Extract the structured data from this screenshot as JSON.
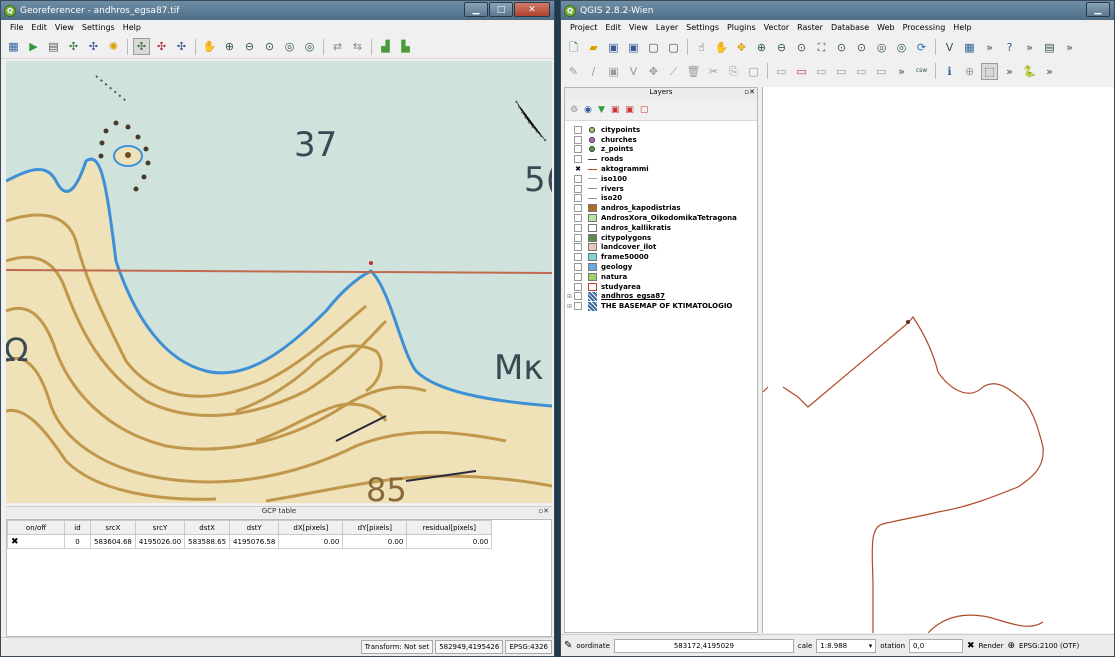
{
  "georef": {
    "title": "Georeferencer - andhros_egsa87.tif",
    "menu": [
      "File",
      "Edit",
      "View",
      "Settings",
      "Help"
    ],
    "toolbar_icons": [
      "add-raster-icon",
      "start-georeferencing-icon",
      "generate-gdal-script-icon",
      "load-gcp-icon",
      "save-gcp-icon",
      "transformation-settings-icon",
      "add-point-icon",
      "delete-point-icon",
      "move-point-icon",
      "pan-icon",
      "zoom-in-icon",
      "zoom-out-icon",
      "zoom-to-layer-icon",
      "zoom-last-icon",
      "zoom-next-icon",
      "link-georef-to-qgis-icon",
      "link-qgis-to-georef-icon",
      "raster-histogram-icon",
      "raster-stretch-icon"
    ],
    "map_labels": {
      "number_37": "37",
      "number_5": "5(",
      "label_mk": "Mκ",
      "label_85": "85",
      "label_q": "Ω"
    },
    "gcp": {
      "title": "GCP table",
      "columns": [
        "on/off",
        "id",
        "srcX",
        "srcY",
        "dstX",
        "dstY",
        "dX[pixels]",
        "dY[pixels]",
        "residual[pixels]"
      ],
      "rows": [
        {
          "onoff": "✖",
          "id": "0",
          "srcX": "583604.68",
          "srcY": "4195026.00",
          "dstX": "583588.65",
          "dstY": "4195076.58",
          "dx": "0.00",
          "dy": "0.00",
          "residual": "0.00"
        }
      ]
    },
    "status": {
      "transform": "Transform: Not set",
      "coords": "582949,4195426",
      "crs": "EPSG:4326"
    }
  },
  "qgis": {
    "title": "QGIS 2.8.2-Wien",
    "menu": [
      "Project",
      "Edit",
      "View",
      "Layer",
      "Settings",
      "Plugins",
      "Vector",
      "Raster",
      "Database",
      "Web",
      "Processing",
      "Help"
    ],
    "layers_title": "Layers",
    "layers": [
      {
        "name": "citypoints",
        "checked": false,
        "symbol": "point",
        "color": "#9dd36c"
      },
      {
        "name": "churches",
        "checked": false,
        "symbol": "point",
        "color": "#b56cc0"
      },
      {
        "name": "z_points",
        "checked": false,
        "symbol": "point",
        "color": "#5aa03a"
      },
      {
        "name": "roads",
        "checked": false,
        "symbol": "line",
        "color": "#444444"
      },
      {
        "name": "aktogrammi",
        "checked": true,
        "symbol": "line",
        "color": "#b0492c"
      },
      {
        "name": "iso100",
        "checked": false,
        "symbol": "line",
        "color": "#c99b8c"
      },
      {
        "name": "rivers",
        "checked": false,
        "symbol": "line",
        "color": "#8e8e8e"
      },
      {
        "name": "iso20",
        "checked": false,
        "symbol": "line",
        "color": "#a08aa0"
      },
      {
        "name": "andros_kapodistrias",
        "checked": false,
        "symbol": "fill",
        "color": "#b06a22"
      },
      {
        "name": "AndrosXora_OikodomikaTetragona",
        "checked": false,
        "symbol": "fill",
        "color": "#b9e3a0"
      },
      {
        "name": "andros_kallikratis",
        "checked": false,
        "symbol": "fill",
        "color": "#ffffff"
      },
      {
        "name": "citypolygons",
        "checked": false,
        "symbol": "fill",
        "color": "#5c8a4e"
      },
      {
        "name": "landcover_ilot",
        "checked": false,
        "symbol": "fill",
        "color": "#e8c8c0"
      },
      {
        "name": "frame50000",
        "checked": false,
        "symbol": "fill",
        "color": "#79d6d0"
      },
      {
        "name": "geology",
        "checked": false,
        "symbol": "fill",
        "color": "#6aa8e0"
      },
      {
        "name": "natura",
        "checked": false,
        "symbol": "fill",
        "color": "#9ed36a"
      },
      {
        "name": "studyarea",
        "checked": false,
        "symbol": "outline",
        "color": "#c0392b"
      },
      {
        "name": "andhros_egsa87",
        "checked": false,
        "symbol": "raster",
        "color": "#3a6aa0",
        "group": true
      },
      {
        "name": "THE BASEMAP OF KTIMATOLOGIO",
        "checked": false,
        "symbol": "raster",
        "color": "#3a6aa0",
        "group": true
      }
    ],
    "status": {
      "coord_label": "oordinate",
      "coord_value": "583172,4195029",
      "scale_label": "cale",
      "scale_value": "1:8.988",
      "rotation_label": "otation",
      "rotation_value": "0,0",
      "render_label": "Render",
      "crs": "EPSG:2100 (OTF)"
    }
  }
}
